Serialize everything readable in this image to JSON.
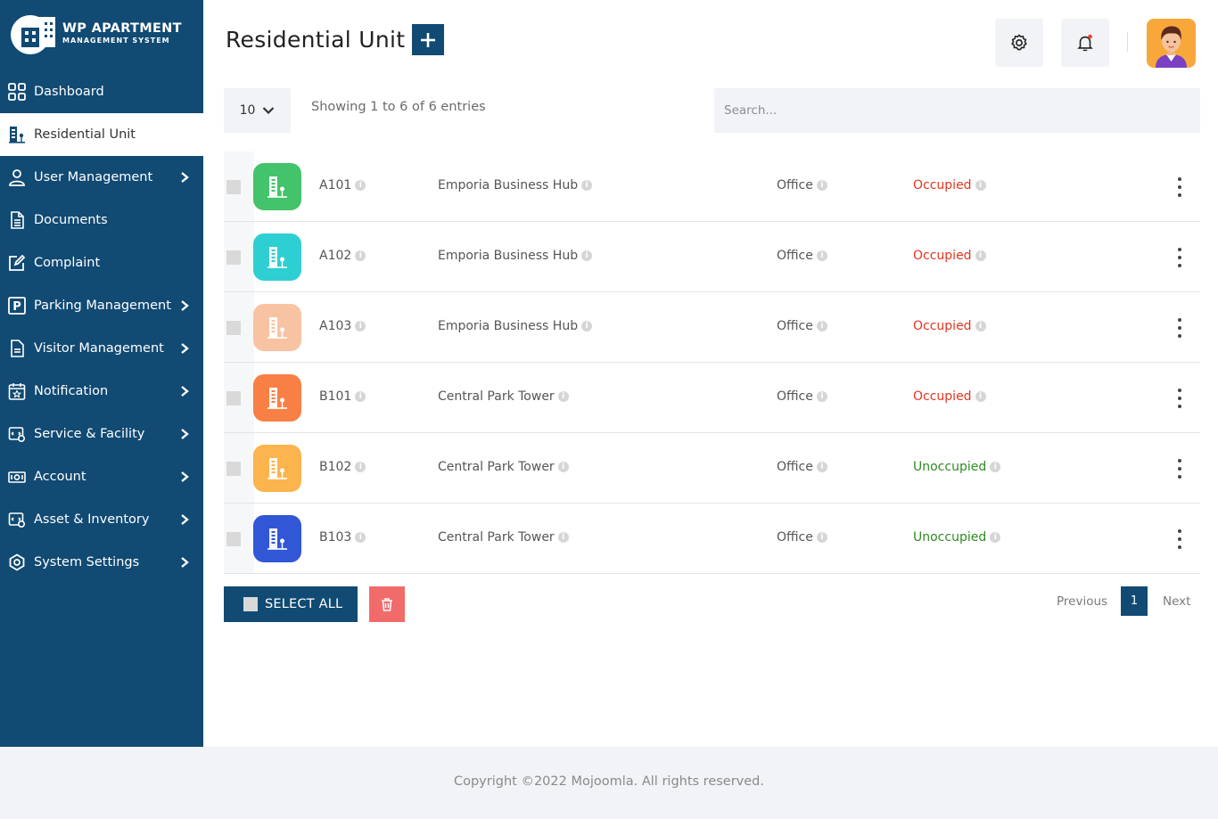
{
  "brand": {
    "line1": "WP APARTMENT",
    "line2": "MANAGEMENT SYSTEM"
  },
  "sidebar": {
    "items": [
      {
        "label": "Dashboard",
        "icon": "dashboard-icon",
        "chevron": false
      },
      {
        "label": "Residential Unit",
        "icon": "building-icon",
        "chevron": false,
        "active": true
      },
      {
        "label": "User Management",
        "icon": "user-icon",
        "chevron": true
      },
      {
        "label": "Documents",
        "icon": "document-icon",
        "chevron": false
      },
      {
        "label": "Complaint",
        "icon": "edit-icon",
        "chevron": false
      },
      {
        "label": "Parking Management",
        "icon": "parking-icon",
        "chevron": true
      },
      {
        "label": "Visitor Management",
        "icon": "visitor-icon",
        "chevron": true
      },
      {
        "label": "Notification",
        "icon": "calendar-star-icon",
        "chevron": true
      },
      {
        "label": "Service & Facility",
        "icon": "service-icon",
        "chevron": true
      },
      {
        "label": "Account",
        "icon": "money-icon",
        "chevron": true
      },
      {
        "label": "Asset & Inventory",
        "icon": "inventory-icon",
        "chevron": true
      },
      {
        "label": "System Settings",
        "icon": "settings-icon",
        "chevron": true
      }
    ]
  },
  "header": {
    "title": "Residential Unit"
  },
  "table_controls": {
    "page_length": "10",
    "info": "Showing 1 to 6 of 6 entries",
    "search_placeholder": "Search..."
  },
  "colors": {
    "primary": "#114a73",
    "occupied": "#e3341e",
    "unoccupied": "#2e8b24",
    "delete": "#f26b6b"
  },
  "units": [
    {
      "unit": "A101",
      "building": "Emporia Business Hub",
      "type": "Office",
      "status": "Occupied",
      "status_class": "occupied",
      "icon_color": "#43c36a"
    },
    {
      "unit": "A102",
      "building": "Emporia Business Hub",
      "type": "Office",
      "status": "Occupied",
      "status_class": "occupied",
      "icon_color": "#2ecfd2"
    },
    {
      "unit": "A103",
      "building": "Emporia Business Hub",
      "type": "Office",
      "status": "Occupied",
      "status_class": "occupied",
      "icon_color": "#f8c3a3"
    },
    {
      "unit": "B101",
      "building": "Central Park Tower",
      "type": "Office",
      "status": "Occupied",
      "status_class": "occupied",
      "icon_color": "#f98044"
    },
    {
      "unit": "B102",
      "building": "Central Park Tower",
      "type": "Office",
      "status": "Unoccupied",
      "status_class": "unoccupied",
      "icon_color": "#fbb44e"
    },
    {
      "unit": "B103",
      "building": "Central Park Tower",
      "type": "Office",
      "status": "Unoccupied",
      "status_class": "unoccupied",
      "icon_color": "#3157d6"
    }
  ],
  "actions": {
    "select_all": "SELECT ALL"
  },
  "pagination": {
    "previous": "Previous",
    "current": "1",
    "next": "Next"
  },
  "footer": {
    "text": "Copyright ©2022 Mojoomla. All rights reserved."
  }
}
